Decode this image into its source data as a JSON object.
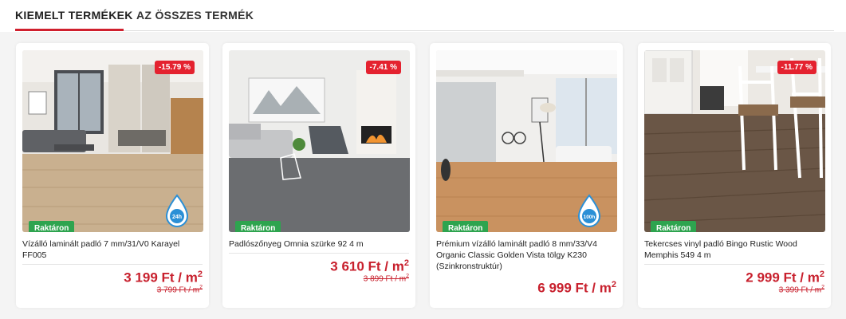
{
  "tabs": [
    {
      "label": "KIEMELT TERMÉKEK",
      "active": true
    },
    {
      "label": "AZ ÖSSZES TERMÉK",
      "active": false
    }
  ],
  "products": [
    {
      "name": "Vízálló laminált padló 7 mm/31/V0 Karayel FF005",
      "discount": "-15.79 %",
      "stock": "Raktáron",
      "badge_icon": "water-drop-24h-icon",
      "badge_text": "24h",
      "price": "3 199 Ft / m",
      "price_unit_sup": "2",
      "old_price": "3 799 Ft / m",
      "old_unit_sup": "2"
    },
    {
      "name": "Padlószőnyeg Omnia szürke 92 4 m",
      "discount": "-7.41 %",
      "stock": "Raktáron",
      "price": "3 610 Ft / m",
      "price_unit_sup": "2",
      "old_price": "3 899 Ft / m",
      "old_unit_sup": "2"
    },
    {
      "name": "Prémium vízálló laminált padló 8 mm/33/V4 Organic Classic Golden Vista tölgy K230 (Szinkronstruktúr)",
      "stock": "Raktáron",
      "badge_icon": "water-drop-100h-icon",
      "badge_text": "100h",
      "price": "6 999 Ft / m",
      "price_unit_sup": "2"
    },
    {
      "name": "Tekercses vinyl padló Bingo Rustic Wood Memphis 549 4 m",
      "discount": "-11.77 %",
      "stock": "Raktáron",
      "price": "2 999 Ft / m",
      "price_unit_sup": "2",
      "old_price": "3 399 Ft / m",
      "old_unit_sup": "2"
    }
  ],
  "colors": {
    "accent": "#d0202e",
    "discount_bg": "#e4222f",
    "stock_bg": "#2ea44f",
    "price": "#c8202d",
    "drop": "#2a8fd6"
  }
}
